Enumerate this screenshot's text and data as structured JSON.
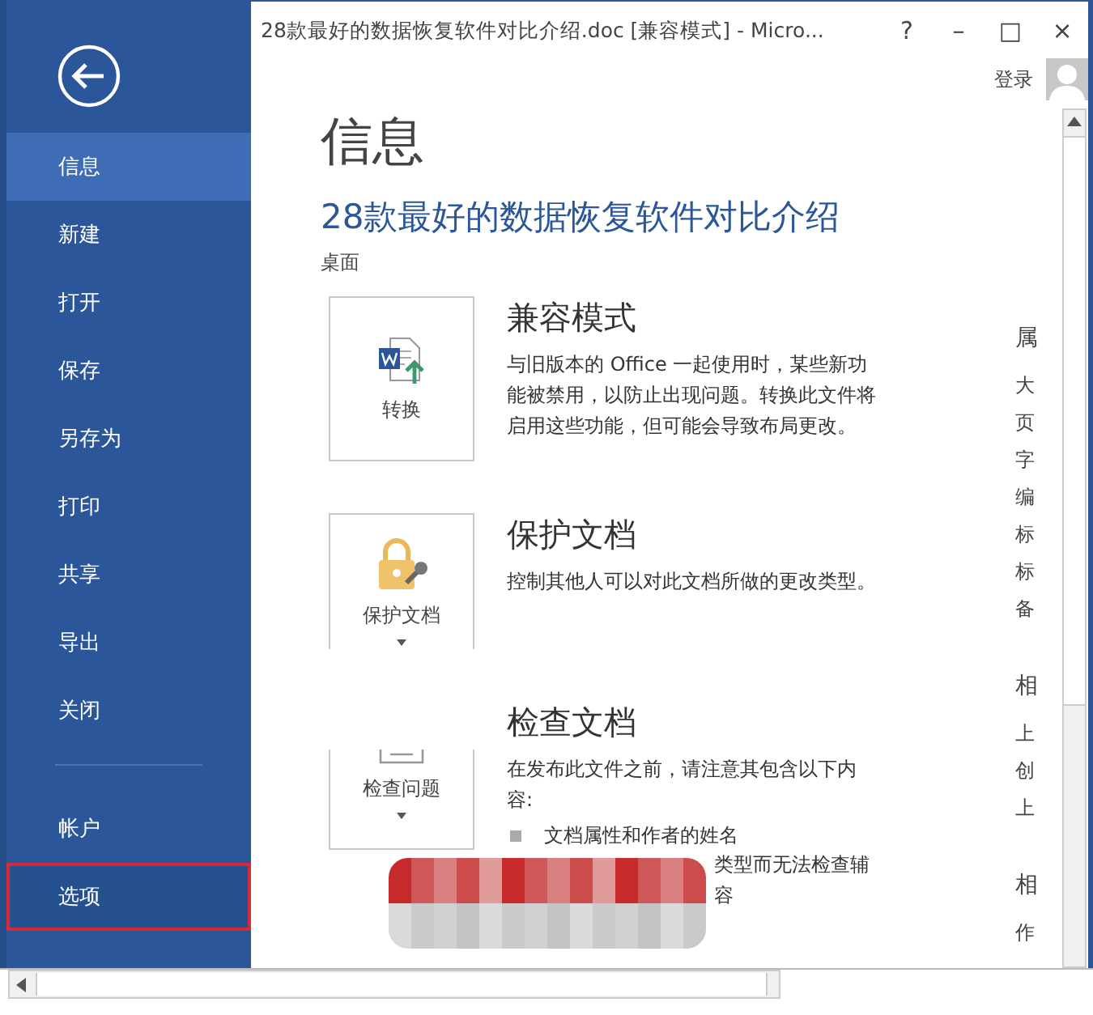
{
  "window": {
    "title": "28款最好的数据恢复软件对比介绍.doc [兼容模式] - Micro...",
    "controls": [
      "?",
      "–",
      "□",
      "×"
    ]
  },
  "account": {
    "sign_in": "登录"
  },
  "sidebar": {
    "groups": [
      {
        "items": [
          {
            "label": "信息",
            "selected": true,
            "outlined": false
          },
          {
            "label": "新建",
            "selected": false,
            "outlined": false
          },
          {
            "label": "打开",
            "selected": false,
            "outlined": false
          },
          {
            "label": "保存",
            "selected": false,
            "outlined": false
          },
          {
            "label": "另存为",
            "selected": false,
            "outlined": false
          },
          {
            "label": "打印",
            "selected": false,
            "outlined": false
          },
          {
            "label": "共享",
            "selected": false,
            "outlined": false
          },
          {
            "label": "导出",
            "selected": false,
            "outlined": false
          },
          {
            "label": "关闭",
            "selected": false,
            "outlined": false
          }
        ]
      },
      {
        "items": [
          {
            "label": "帐户",
            "selected": false,
            "outlined": false
          },
          {
            "label": "选项",
            "selected": false,
            "outlined": true
          }
        ]
      }
    ]
  },
  "page": {
    "heading": "信息",
    "document_title": "28款最好的数据恢复软件对比介绍",
    "location": "桌面"
  },
  "sections": [
    {
      "kind": "convert",
      "button": "转换",
      "dropdown": false,
      "title": "兼容模式",
      "description": "与旧版本的 Office 一起使用时，某些新功能被禁用，以防止出现问题。转换此文件将启用这些功能，但可能会导致布局更改。"
    },
    {
      "kind": "protect",
      "button": "保护文档",
      "dropdown": true,
      "title": "保护文档",
      "description": "控制其他人可以对此文档所做的更改类型。"
    },
    {
      "kind": "inspect",
      "button": "检查问题",
      "dropdown": true,
      "title": "检查文档",
      "description": "在发布此文件之前，请注意其包含以下内容:",
      "bullets": [
        "文档属性和作者的姓名"
      ],
      "fragments": [
        "类型而无法检查辅",
        "容"
      ]
    }
  ],
  "properties": [
    {
      "text": "属",
      "kind": "heading"
    },
    {
      "text": "大",
      "kind": "row"
    },
    {
      "text": "页",
      "kind": "row"
    },
    {
      "text": "字",
      "kind": "row"
    },
    {
      "text": "编",
      "kind": "row"
    },
    {
      "text": "标",
      "kind": "row"
    },
    {
      "text": "标",
      "kind": "row"
    },
    {
      "text": "备",
      "kind": "row"
    },
    {
      "text": "相",
      "kind": "heading"
    },
    {
      "text": "上",
      "kind": "row"
    },
    {
      "text": "创",
      "kind": "row"
    },
    {
      "text": "上",
      "kind": "row"
    },
    {
      "text": "相",
      "kind": "heading"
    },
    {
      "text": "作",
      "kind": "row"
    }
  ]
}
